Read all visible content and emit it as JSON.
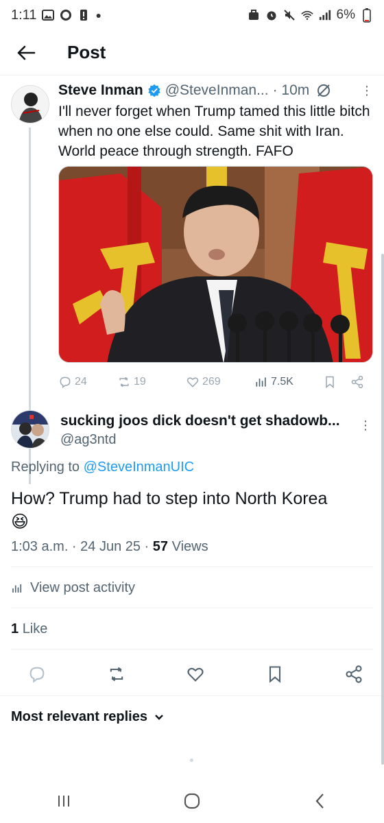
{
  "status_bar": {
    "time": "1:11",
    "battery": "6%"
  },
  "header": {
    "title": "Post"
  },
  "tweet1": {
    "name": "Steve Inman",
    "handle": "@SteveInman...",
    "time": "· 10m",
    "text": "I'll never forget when Trump tamed this little bitch when no one else could. Same shit with Iran. World peace through strength. FAFO",
    "replies": "24",
    "reposts": "19",
    "likes": "269",
    "views": "7.5K"
  },
  "tweet2": {
    "name": "sucking joos dick doesn't get shadowb...",
    "handle": "@ag3ntd",
    "replying_prefix": "Replying to",
    "replying_to": "@SteveInmanUIC",
    "text": "How?  Trump had to step into North Korea",
    "emoji": "😆",
    "time_date": "1:03 a.m. · 24 Jun 25 ·",
    "views_count": "57",
    "views_label": "Views",
    "view_activity": "View post activity",
    "like_count": "1",
    "like_label": "Like"
  },
  "replies_sort": {
    "label": "Most relevant replies"
  },
  "colors": {
    "accent": "#1d9bf0",
    "muted": "#536471",
    "text": "#0f1419"
  }
}
